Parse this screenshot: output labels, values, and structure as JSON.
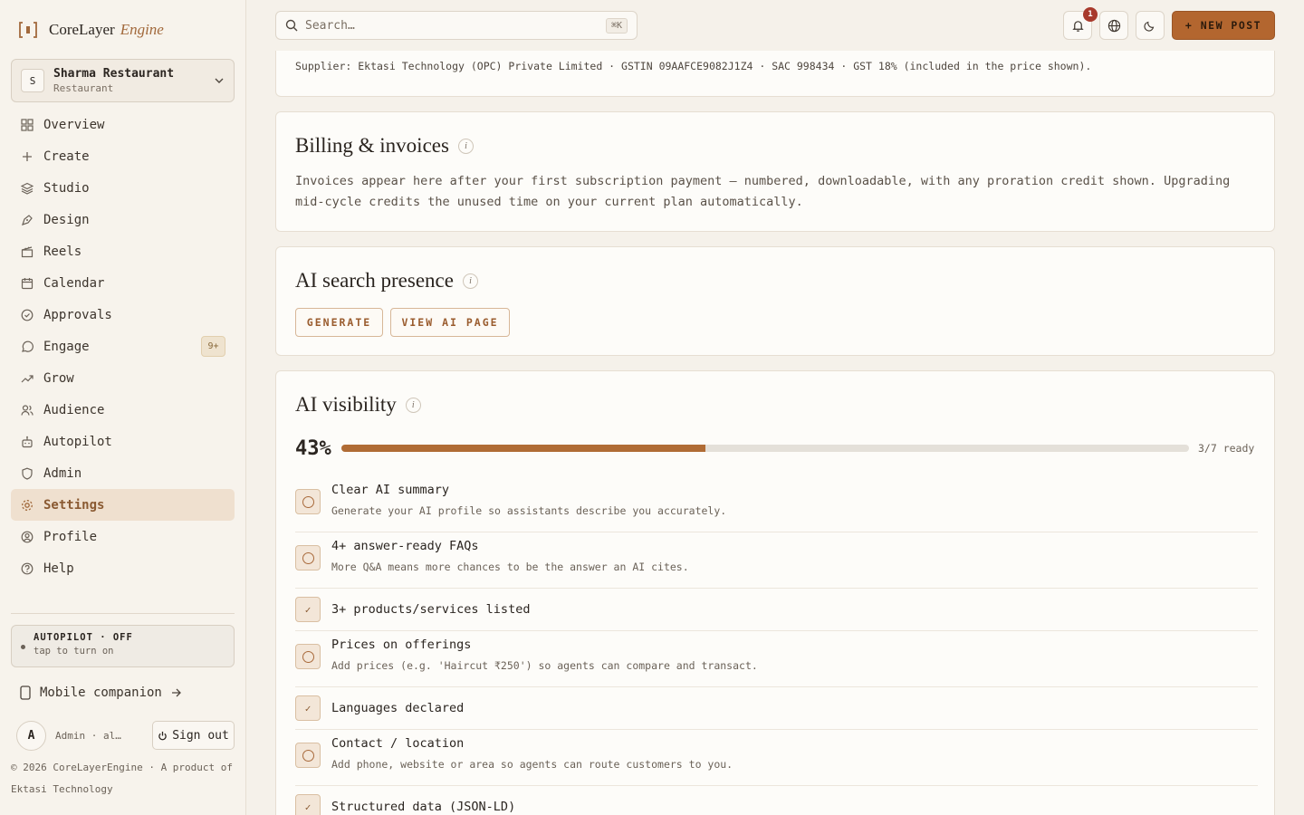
{
  "brand": {
    "name": "CoreLayer",
    "suffix": "Engine"
  },
  "workspace": {
    "initial": "S",
    "name": "Sharma Restaurant",
    "type": "Restaurant"
  },
  "nav": [
    {
      "label": "Overview",
      "icon": "grid-icon"
    },
    {
      "label": "Create",
      "icon": "plus-icon"
    },
    {
      "label": "Studio",
      "icon": "layers-icon"
    },
    {
      "label": "Design",
      "icon": "pen-nib-icon"
    },
    {
      "label": "Reels",
      "icon": "clapperboard-icon"
    },
    {
      "label": "Calendar",
      "icon": "calendar-icon"
    },
    {
      "label": "Approvals",
      "icon": "check-circle-icon"
    },
    {
      "label": "Engage",
      "icon": "chat-bubble-icon",
      "badge": "9+"
    },
    {
      "label": "Grow",
      "icon": "trending-up-icon"
    },
    {
      "label": "Audience",
      "icon": "users-icon"
    },
    {
      "label": "Autopilot",
      "icon": "bot-icon"
    },
    {
      "label": "Admin",
      "icon": "shield-icon"
    },
    {
      "label": "Settings",
      "icon": "gear-icon",
      "active": true
    },
    {
      "label": "Profile",
      "icon": "user-circle-icon"
    },
    {
      "label": "Help",
      "icon": "help-circle-icon"
    }
  ],
  "autopilot": {
    "title": "AUTOPILOT · OFF",
    "subtitle": "tap to turn on"
  },
  "mobile": {
    "label": "Mobile companion"
  },
  "user": {
    "initial": "A",
    "name": "Admin · al…",
    "signout_label": "Sign out"
  },
  "footer": {
    "copyright": "© 2026 CoreLayerEngine · A product of Ektasi Technology"
  },
  "header": {
    "search_placeholder": "Search…",
    "search_shortcut": "⌘K",
    "notification_count": "1",
    "new_post_label": "+ NEW POST"
  },
  "supplier_note": "Supplier: Ektasi Technology (OPC) Private Limited · GSTIN 09AAFCE9082J1Z4 · SAC 998434 · GST 18% (included in the price shown).",
  "billing": {
    "title": "Billing & invoices",
    "body": "Invoices appear here after your first subscription payment — numbered, downloadable, with any proration credit shown. Upgrading mid-cycle credits the unused time on your current plan automatically."
  },
  "ai_search": {
    "title": "AI search presence",
    "generate_label": "GENERATE",
    "view_label": "VIEW AI PAGE"
  },
  "ai_visibility": {
    "title": "AI visibility",
    "percent_label": "43%",
    "progress": 0.43,
    "ready_label": "3/7 ready",
    "items": [
      {
        "title": "Clear AI summary",
        "subtitle": "Generate your AI profile so assistants describe you accurately.",
        "done": false
      },
      {
        "title": "4+ answer-ready FAQs",
        "subtitle": "More Q&A means more chances to be the answer an AI cites.",
        "done": false
      },
      {
        "title": "3+ products/services listed",
        "subtitle": "",
        "done": true
      },
      {
        "title": "Prices on offerings",
        "subtitle": "Add prices (e.g. 'Haircut ₹250') so agents can compare and transact.",
        "done": false
      },
      {
        "title": "Languages declared",
        "subtitle": "",
        "done": true
      },
      {
        "title": "Contact / location",
        "subtitle": "Add phone, website or area so agents can route customers to you.",
        "done": false
      },
      {
        "title": "Structured data (JSON-LD)",
        "subtitle": "",
        "done": true
      }
    ]
  },
  "colors": {
    "accent": "#b3662f",
    "sidebar_active_bg": "#efe0cf",
    "badge_red": "#a83a2c",
    "progress_fill": "#b06c35"
  }
}
